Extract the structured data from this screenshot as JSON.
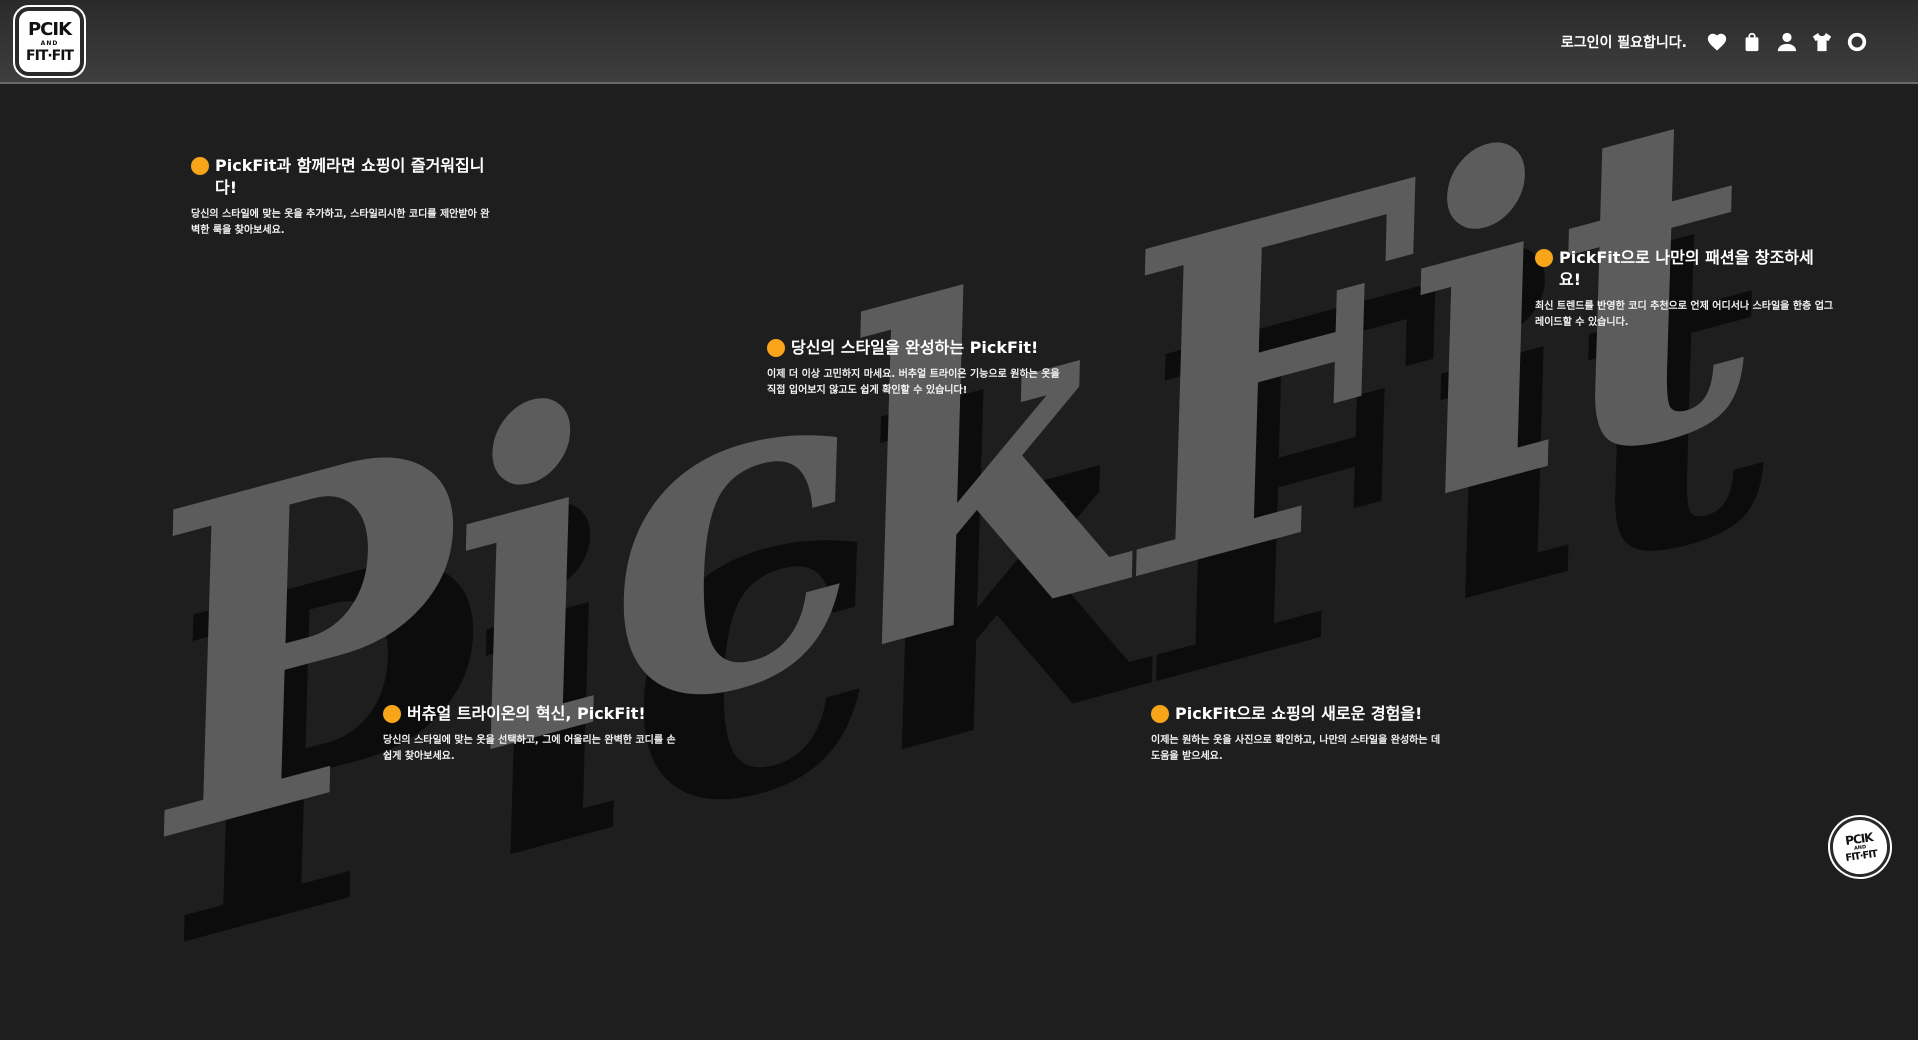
{
  "header": {
    "logo_line1": "PCIK",
    "logo_line2": "AND",
    "logo_line3": "FIT·FIT",
    "login_message": "로그인이 필요합니다.",
    "icons": [
      "heart-icon",
      "shopping-bag-icon",
      "user-icon",
      "shirt-icon",
      "circle-icon"
    ]
  },
  "hero": {
    "background_word": "PickFit"
  },
  "cards": [
    {
      "title": "PickFit과 함께라면 쇼핑이 즐거워집니다!",
      "body": "당신의 스타일에 맞는 옷을 추가하고, 스타일리시한 코디를 제안받아 완벽한 룩을 찾아보세요."
    },
    {
      "title": "당신의 스타일을 완성하는 PickFit!",
      "body": "이제 더 이상 고민하지 마세요. 버추얼 트라이온 기능으로 원하는 옷을 직접 입어보지 않고도 쉽게 확인할 수 있습니다!"
    },
    {
      "title": "PickFit으로 나만의 패션을 창조하세요!",
      "body": "최신 트렌드를 반영한 코디 추천으로 언제 어디서나 스타일을 한층 업그레이드할 수 있습니다."
    },
    {
      "title": "버츄얼 트라이온의 혁신, PickFit!",
      "body": "당신의 스타일에 맞는 옷을 선택하고, 그에 어울리는 완벽한 코디를 손쉽게 찾아보세요."
    },
    {
      "title": "PickFit으로 쇼핑의 새로운 경험을!",
      "body": "이제는 원하는 옷을 사진으로 확인하고, 나만의 스타일을 완성하는 데 도움을 받으세요."
    }
  ],
  "floating_logo": {
    "line1": "PCIK",
    "line2": "AND",
    "line3": "FIT·FIT"
  },
  "colors": {
    "accent": "#f8a51a",
    "background": "#1e1e1e",
    "header": "#3a3a3a",
    "hero_text": "#5c5c5c"
  }
}
